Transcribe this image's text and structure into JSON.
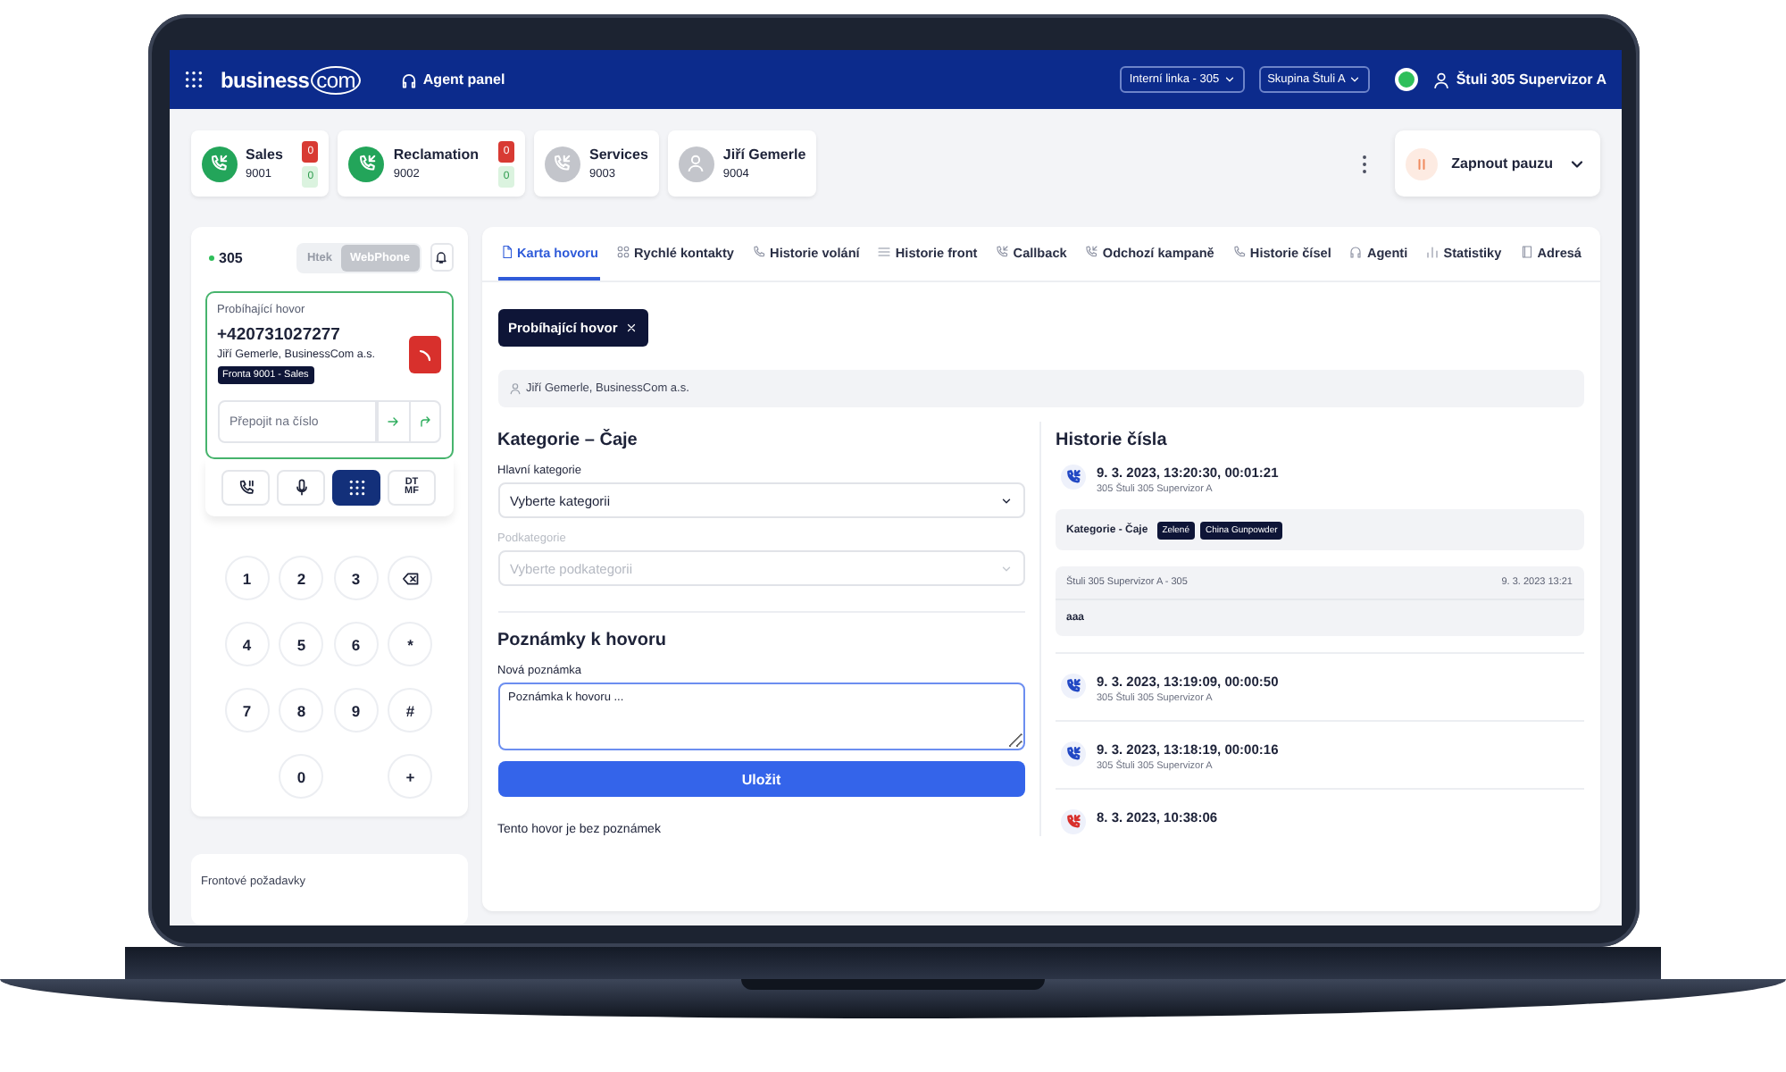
{
  "topbar": {
    "logo": {
      "main": "business",
      "suffix": "com"
    },
    "module": "Agent panel",
    "line_select": "Interní linka - 305",
    "group_select": "Skupina Štuli A",
    "online": true,
    "user": "Štuli 305 Supervizor A"
  },
  "queues": [
    {
      "kind": "queue",
      "name": "Sales",
      "number": "9001",
      "active": true,
      "counts": [
        "0",
        "0"
      ]
    },
    {
      "kind": "queue",
      "name": "Reclamation",
      "number": "9002",
      "active": true,
      "counts": [
        "0",
        "0"
      ]
    },
    {
      "kind": "queue",
      "name": "Services",
      "number": "9003",
      "active": false
    },
    {
      "kind": "agent",
      "name": "Jiří Gemerle",
      "number": "9004",
      "active": false
    }
  ],
  "pause_button": "Zapnout pauzu",
  "phone": {
    "extension": "305",
    "online": true,
    "modes": [
      {
        "label": "Htek",
        "selected": false
      },
      {
        "label": "WebPhone",
        "selected": true
      }
    ],
    "call": {
      "title": "Probíhající hovor",
      "number": "+420731027277",
      "contact": "Jiří Gemerle, BusinessCom a.s.",
      "queue_tag": "Fronta 9001 - Sales",
      "transfer_placeholder": "Přepojit na číslo"
    },
    "controls": [
      {
        "kind": "hold",
        "selected": false
      },
      {
        "kind": "mute",
        "selected": false
      },
      {
        "kind": "keypad",
        "selected": true
      },
      {
        "kind": "dtmf",
        "label": "DTMF",
        "selected": false
      }
    ],
    "keypad": [
      {
        "kind": "digit",
        "label": "1"
      },
      {
        "kind": "digit",
        "label": "2"
      },
      {
        "kind": "digit",
        "label": "3"
      },
      {
        "kind": "backspace"
      },
      {
        "kind": "digit",
        "label": "4"
      },
      {
        "kind": "digit",
        "label": "5"
      },
      {
        "kind": "digit",
        "label": "6"
      },
      {
        "kind": "digit",
        "label": "*"
      },
      {
        "kind": "digit",
        "label": "7"
      },
      {
        "kind": "digit",
        "label": "8"
      },
      {
        "kind": "digit",
        "label": "9"
      },
      {
        "kind": "digit",
        "label": "#"
      },
      {
        "kind": "blank"
      },
      {
        "kind": "digit",
        "label": "0"
      },
      {
        "kind": "blank"
      },
      {
        "kind": "digit",
        "label": "+"
      }
    ]
  },
  "queue_requests": "Frontové požadavky",
  "tabs": [
    {
      "label": "Karta hovoru",
      "kind": "doc",
      "selected": true
    },
    {
      "label": "Rychlé kontakty",
      "kind": "contacts",
      "selected": false
    },
    {
      "label": "Historie volání",
      "kind": "phone",
      "selected": false
    },
    {
      "label": "Historie front",
      "kind": "list",
      "selected": false
    },
    {
      "label": "Callback",
      "kind": "callback",
      "selected": false
    },
    {
      "label": "Odchozí kampaně",
      "kind": "callback",
      "selected": false
    },
    {
      "label": "Historie čísel",
      "kind": "phone",
      "selected": false
    },
    {
      "label": "Agenti",
      "kind": "headset",
      "selected": false
    },
    {
      "label": "Statistiky",
      "kind": "chart",
      "selected": false
    },
    {
      "label": "Adresá",
      "kind": "book",
      "selected": false
    }
  ],
  "chip": "Probíhající hovor",
  "contact": "Jiří Gemerle, BusinessCom a.s.",
  "category": {
    "title": "Kategorie – Čaje",
    "main_label": "Hlavní kategorie",
    "main_value": "Vyberte kategorii",
    "sub_label": "Podkategorie",
    "sub_placeholder": "Vyberte podkategorii",
    "sub_disabled": true
  },
  "notes": {
    "title": "Poznámky k hovoru",
    "label": "Nová poznámka",
    "value": "Poznámka k hovoru ...",
    "save": "Uložit",
    "empty": "Tento hovor je bez poznámek"
  },
  "history": {
    "title": "Historie čísla",
    "entries": [
      {
        "time": "9. 3. 2023, 13:20:30, 00:01:21",
        "agent": "305 Štuli 305 Supervizor A",
        "missed": false,
        "category": {
          "label": "Kategorie - Čaje",
          "tags": [
            "Zelené",
            "China Gunpowder"
          ]
        },
        "note": {
          "author": "Štuli 305 Supervizor A - 305",
          "date": "9. 3. 2023 13:21",
          "text": "aaa"
        }
      },
      {
        "time": "9. 3. 2023, 13:19:09, 00:00:50",
        "agent": "305 Štuli 305 Supervizor A",
        "missed": false
      },
      {
        "time": "9. 3. 2023, 13:18:19, 00:00:16",
        "agent": "305 Štuli 305 Supervizor A",
        "missed": false
      },
      {
        "time": "8. 3. 2023, 10:38:06",
        "missed": true
      }
    ]
  }
}
